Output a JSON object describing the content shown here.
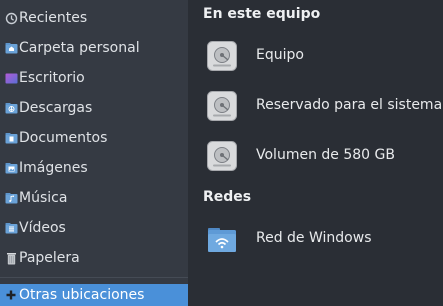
{
  "sidebar": {
    "items": [
      {
        "label": "Recientes",
        "icon": "recent-icon"
      },
      {
        "label": "Carpeta personal",
        "icon": "home-folder-icon"
      },
      {
        "label": "Escritorio",
        "icon": "desktop-folder-icon"
      },
      {
        "label": "Descargas",
        "icon": "downloads-folder-icon"
      },
      {
        "label": "Documentos",
        "icon": "documents-folder-icon"
      },
      {
        "label": "Imágenes",
        "icon": "pictures-folder-icon"
      },
      {
        "label": "Música",
        "icon": "music-folder-icon"
      },
      {
        "label": "Vídeos",
        "icon": "videos-folder-icon"
      },
      {
        "label": "Papelera",
        "icon": "trash-icon"
      },
      {
        "label": "Otras ubicaciones",
        "icon": "plus-icon",
        "active": true
      }
    ]
  },
  "main": {
    "section_this_computer": "En este equipo",
    "drives": [
      {
        "label": "Equipo",
        "icon": "hard-drive-icon"
      },
      {
        "label": "Reservado para el sistema",
        "icon": "hard-drive-icon"
      },
      {
        "label": "Volumen de 580 GB",
        "icon": "hard-drive-icon"
      }
    ],
    "section_networks": "Redes",
    "networks": [
      {
        "label": "Red de Windows",
        "icon": "network-folder-icon"
      }
    ]
  },
  "colors": {
    "sidebar_bg": "#353a43",
    "main_bg": "#2a2e35",
    "accent": "#4a90d9"
  }
}
